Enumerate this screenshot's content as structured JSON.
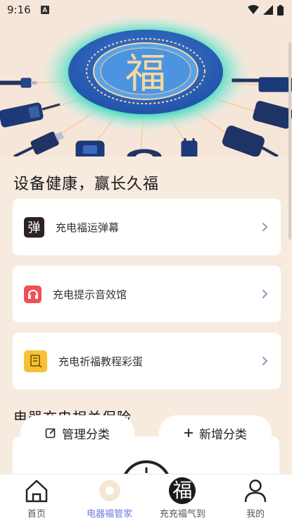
{
  "status": {
    "time": "9:16",
    "notification_badge": "A"
  },
  "hero": {
    "center_character": "福"
  },
  "section_title": "设备健康，赢长久福",
  "cards": [
    {
      "label": "充电福运弹幕",
      "icon": "danmu-icon",
      "icon_text": "弹",
      "icon_color": "#2b2222"
    },
    {
      "label": "充电提示音效馆",
      "icon": "headphones-icon",
      "icon_color": "#f0505a"
    },
    {
      "label": "充电祈福教程彩蛋",
      "icon": "tutorial-icon",
      "icon_color": "#f6c233"
    }
  ],
  "sub_title": "电器充电相关保险",
  "pills": {
    "manage_label": "管理分类",
    "add_label": "新增分类"
  },
  "tabbar": {
    "items": [
      {
        "label": "首页",
        "icon": "home-icon",
        "active": false
      },
      {
        "label": "电器福管家",
        "icon": "plate-icon",
        "active": true
      },
      {
        "label": "充充福气到",
        "icon": "fu-icon",
        "icon_text": "福",
        "active": false
      },
      {
        "label": "我的",
        "icon": "profile-icon",
        "active": false
      }
    ],
    "active_color": "#6b7bd8"
  }
}
